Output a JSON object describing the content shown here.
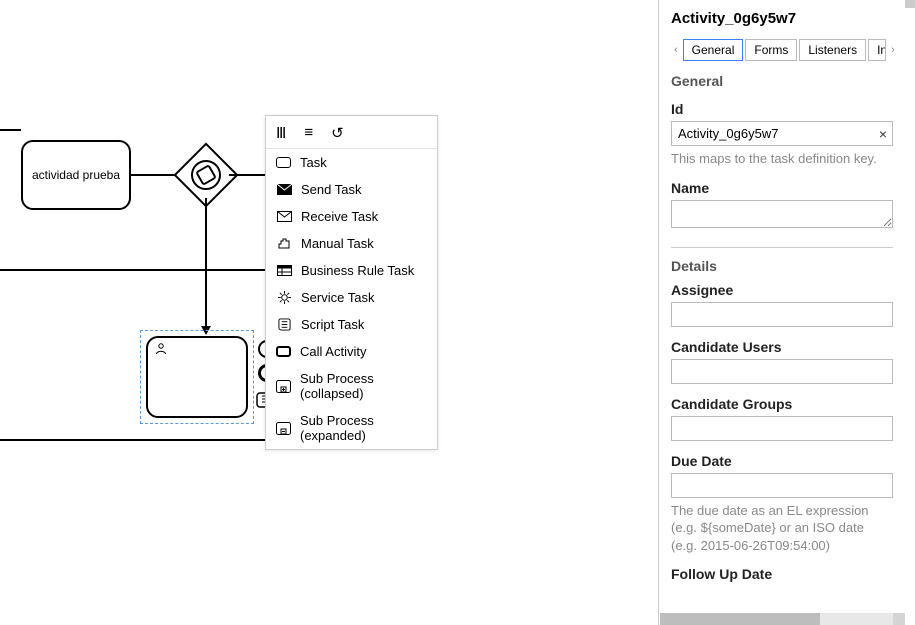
{
  "canvas": {
    "task_label": "actividad prueba"
  },
  "context_menu": {
    "items": [
      "Task",
      "Send Task",
      "Receive Task",
      "Manual Task",
      "Business Rule Task",
      "Service Task",
      "Script Task",
      "Call Activity",
      "Sub Process (collapsed)",
      "Sub Process (expanded)"
    ]
  },
  "panel": {
    "title": "Activity_0g6y5w7",
    "tabs": [
      "General",
      "Forms",
      "Listeners",
      "Input/O"
    ],
    "section_general": "General",
    "id_label": "Id",
    "id_value": "Activity_0g6y5w7",
    "id_help": "This maps to the task definition key.",
    "name_label": "Name",
    "section_details": "Details",
    "assignee_label": "Assignee",
    "cand_users_label": "Candidate Users",
    "cand_groups_label": "Candidate Groups",
    "due_label": "Due Date",
    "due_help": "The due date as an EL expression (e.g. ${someDate} or an ISO date (e.g. 2015-06-26T09:54:00)",
    "followup_label": "Follow Up Date"
  }
}
